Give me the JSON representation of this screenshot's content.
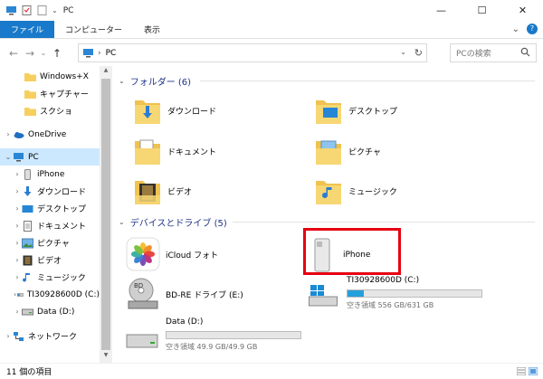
{
  "window": {
    "title": "PC",
    "minimize": "—",
    "maximize": "☐",
    "close": "✕"
  },
  "ribbon": {
    "tabs": [
      "ファイル",
      "コンピューター",
      "表示"
    ],
    "collapse": "⌄",
    "help": "?"
  },
  "address": {
    "back": "←",
    "forward": "→",
    "recent": "⌄",
    "up": "↑",
    "separator": "›",
    "path": "PC",
    "dropdown": "⌄",
    "refresh": "↻"
  },
  "search": {
    "placeholder": "PCの検索"
  },
  "sidebar": {
    "items": [
      {
        "label": "Windows+X",
        "icon": "folder-icon"
      },
      {
        "label": "キャプチャー",
        "icon": "folder-icon"
      },
      {
        "label": "スクショ",
        "icon": "folder-icon"
      },
      {
        "label": "OneDrive",
        "icon": "cloud-icon"
      },
      {
        "label": "PC",
        "icon": "pc-icon"
      },
      {
        "label": "iPhone",
        "icon": "phone-icon"
      },
      {
        "label": "ダウンロード",
        "icon": "download-icon"
      },
      {
        "label": "デスクトップ",
        "icon": "desktop-icon"
      },
      {
        "label": "ドキュメント",
        "icon": "document-icon"
      },
      {
        "label": "ピクチャ",
        "icon": "picture-icon"
      },
      {
        "label": "ビデオ",
        "icon": "video-icon"
      },
      {
        "label": "ミュージック",
        "icon": "music-icon"
      },
      {
        "label": "TI30928600D (C:)",
        "icon": "drive-icon"
      },
      {
        "label": "Data (D:)",
        "icon": "drive-icon"
      },
      {
        "label": "ネットワーク",
        "icon": "network-icon"
      }
    ]
  },
  "main": {
    "folders_header": "フォルダー (6)",
    "folders": [
      "ダウンロード",
      "デスクトップ",
      "ドキュメント",
      "ピクチャ",
      "ビデオ",
      "ミュージック"
    ],
    "devices_header": "デバイスとドライブ (5)",
    "devices": {
      "icloud": "iCloud フォト",
      "iphone": "iPhone",
      "bd": "BD-RE ドライブ (E:)",
      "c_name": "TI30928600D (C:)",
      "c_free": "空き領域 556 GB/631 GB",
      "c_used_fraction": 0.12,
      "d_name": "Data (D:)",
      "d_free": "空き領域 49.9 GB/49.9 GB",
      "d_used_fraction": 0.0
    }
  },
  "status": {
    "count": "11 個の項目"
  },
  "colors": {
    "accent": "#1979ca",
    "selection": "#cce8ff",
    "highlight_box": "#e60012",
    "drive_bar": "#26a0da",
    "header_text": "#1e3287"
  }
}
